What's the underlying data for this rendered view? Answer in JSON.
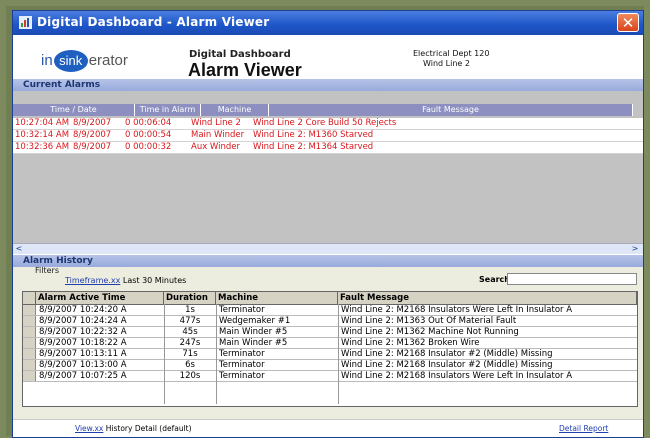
{
  "window": {
    "title": "Digital Dashboard - Alarm Viewer",
    "close_glyph": "✕"
  },
  "header": {
    "logo": {
      "prefix": "in",
      "middle": "sink",
      "suffix": "erator"
    },
    "subtitle": "Digital Dashboard",
    "title": "Alarm Viewer",
    "dept": "Electrical Dept 120",
    "line": "Wind Line 2"
  },
  "current_alarms": {
    "label": "Current Alarms",
    "columns": [
      "Time / Date",
      "Time in Alarm",
      "Machine",
      "Fault Message"
    ],
    "rows": [
      {
        "time": "10:27:04 AM",
        "date": "8/9/2007",
        "duration": "0 00:06:04",
        "machine": "Wind Line 2",
        "message": "Wind Line 2 Core Build 50 Rejects"
      },
      {
        "time": "10:32:14 AM",
        "date": "8/9/2007",
        "duration": "0 00:00:54",
        "machine": "Main Winder",
        "message": "Wind Line 2: M1360 Starved"
      },
      {
        "time": "10:32:36 AM",
        "date": "8/9/2007",
        "duration": "0 00:00:32",
        "machine": "Aux Winder",
        "message": "Wind Line 2: M1364 Starved"
      }
    ]
  },
  "alarm_history": {
    "label": "Alarm History",
    "filters_label": "Filters",
    "timeframe_link": "Timeframe.xx",
    "timeframe_value": "Last 30 Minutes",
    "search_label": "Search:",
    "search_value": "",
    "columns": [
      "Alarm Active Time",
      "Duration",
      "Machine",
      "Fault Message"
    ],
    "rows": [
      {
        "time": "8/9/2007 10:24:20 A",
        "duration": "1s",
        "machine": "Terminator",
        "message": "Wind Line 2: M2168 Insulators Were Left In Insulator A"
      },
      {
        "time": "8/9/2007 10:24:24 A",
        "duration": "477s",
        "machine": "Wedgemaker #1",
        "message": "Wind Line 2: M1363 Out Of Material Fault"
      },
      {
        "time": "8/9/2007 10:22:32 A",
        "duration": "45s",
        "machine": "Main Winder #5",
        "message": "Wind Line 2: M1362 Machine Not Running"
      },
      {
        "time": "8/9/2007 10:18:22 A",
        "duration": "247s",
        "machine": "Main Winder #5",
        "message": "Wind Line 2: M1362 Broken Wire"
      },
      {
        "time": "8/9/2007 10:13:11 A",
        "duration": "71s",
        "machine": "Terminator",
        "message": "Wind Line 2: M2168 Insulator #2 (Middle) Missing"
      },
      {
        "time": "8/9/2007 10:13:00 A",
        "duration": "6s",
        "machine": "Terminator",
        "message": "Wind Line 2: M2168 Insulator #2 (Middle) Missing"
      },
      {
        "time": "8/9/2007 10:07:25 A",
        "duration": "120s",
        "machine": "Terminator",
        "message": "Wind Line 2: M2168 Insulators Were Left In Insulator A"
      }
    ]
  },
  "footer": {
    "view_link": "View.xx",
    "view_value": "History Detail (default)",
    "detail_report_link": "Detail Report"
  },
  "scrollbar": {
    "left_glyph": "<",
    "right_glyph": ">"
  },
  "colors": {
    "alarm_text": "#d8161b",
    "titlebar": "#1d55c8",
    "band": "#98aadb"
  }
}
